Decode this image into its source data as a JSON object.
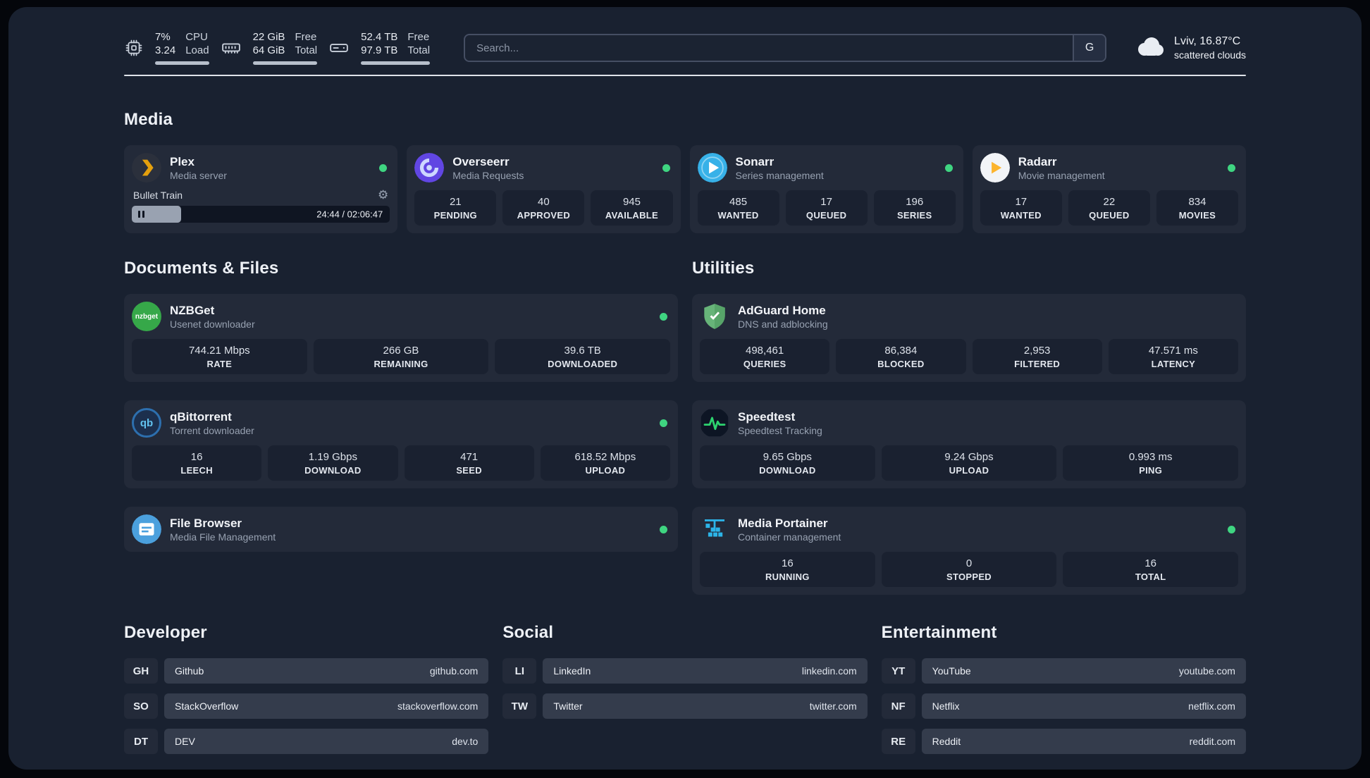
{
  "topbar": {
    "cpu": {
      "value_top": "7%",
      "value_bottom": "3.24",
      "label_top": "CPU",
      "label_bottom": "Load"
    },
    "ram": {
      "value_top": "22 GiB",
      "value_bottom": "64 GiB",
      "label_top": "Free",
      "label_bottom": "Total"
    },
    "disk": {
      "value_top": "52.4 TB",
      "value_bottom": "97.9 TB",
      "label_top": "Free",
      "label_bottom": "Total"
    },
    "search": {
      "placeholder": "Search...",
      "engine_label": "G"
    },
    "weather": {
      "location": "Lviv, 16.87°C",
      "condition": "scattered clouds"
    }
  },
  "sections": {
    "media_title": "Media",
    "documents_title": "Documents & Files",
    "utilities_title": "Utilities"
  },
  "icons": {
    "gear": "⚙"
  },
  "apps": {
    "plex": {
      "name": "Plex",
      "subtitle": "Media server",
      "now_playing": "Bullet Train",
      "time": "24:44 / 02:06:47",
      "progress_style": "width:19%"
    },
    "overseerr": {
      "name": "Overseerr",
      "subtitle": "Media Requests",
      "stats": [
        {
          "value": "21",
          "label": "PENDING"
        },
        {
          "value": "40",
          "label": "APPROVED"
        },
        {
          "value": "945",
          "label": "AVAILABLE"
        }
      ]
    },
    "sonarr": {
      "name": "Sonarr",
      "subtitle": "Series management",
      "stats": [
        {
          "value": "485",
          "label": "WANTED"
        },
        {
          "value": "17",
          "label": "QUEUED"
        },
        {
          "value": "196",
          "label": "SERIES"
        }
      ]
    },
    "radarr": {
      "name": "Radarr",
      "subtitle": "Movie management",
      "stats": [
        {
          "value": "17",
          "label": "WANTED"
        },
        {
          "value": "22",
          "label": "QUEUED"
        },
        {
          "value": "834",
          "label": "MOVIES"
        }
      ]
    },
    "nzbget": {
      "name": "NZBGet",
      "subtitle": "Usenet downloader",
      "icon_text": "nzbget",
      "stats": [
        {
          "value": "744.21 Mbps",
          "label": "RATE"
        },
        {
          "value": "266 GB",
          "label": "REMAINING"
        },
        {
          "value": "39.6 TB",
          "label": "DOWNLOADED"
        }
      ]
    },
    "qbittorrent": {
      "name": "qBittorrent",
      "subtitle": "Torrent downloader",
      "icon_text": "qb",
      "stats": [
        {
          "value": "16",
          "label": "LEECH"
        },
        {
          "value": "1.19 Gbps",
          "label": "DOWNLOAD"
        },
        {
          "value": "471",
          "label": "SEED"
        },
        {
          "value": "618.52 Mbps",
          "label": "UPLOAD"
        }
      ]
    },
    "filebrowser": {
      "name": "File Browser",
      "subtitle": "Media File Management"
    },
    "adguard": {
      "name": "AdGuard Home",
      "subtitle": "DNS and adblocking",
      "stats": [
        {
          "value": "498,461",
          "label": "QUERIES"
        },
        {
          "value": "86,384",
          "label": "BLOCKED"
        },
        {
          "value": "2,953",
          "label": "FILTERED"
        },
        {
          "value": "47.571 ms",
          "label": "LATENCY"
        }
      ]
    },
    "speedtest": {
      "name": "Speedtest",
      "subtitle": "Speedtest Tracking",
      "stats": [
        {
          "value": "9.65 Gbps",
          "label": "DOWNLOAD"
        },
        {
          "value": "9.24 Gbps",
          "label": "UPLOAD"
        },
        {
          "value": "0.993 ms",
          "label": "PING"
        }
      ]
    },
    "portainer": {
      "name": "Media Portainer",
      "subtitle": "Container management",
      "stats": [
        {
          "value": "16",
          "label": "RUNNING"
        },
        {
          "value": "0",
          "label": "STOPPED"
        },
        {
          "value": "16",
          "label": "TOTAL"
        }
      ]
    }
  },
  "bookmarks": [
    {
      "title": "Developer",
      "items": [
        {
          "abbr": "GH",
          "name": "Github",
          "url": "github.com"
        },
        {
          "abbr": "SO",
          "name": "StackOverflow",
          "url": "stackoverflow.com"
        },
        {
          "abbr": "DT",
          "name": "DEV",
          "url": "dev.to"
        }
      ]
    },
    {
      "title": "Social",
      "items": [
        {
          "abbr": "LI",
          "name": "LinkedIn",
          "url": "linkedin.com"
        },
        {
          "abbr": "TW",
          "name": "Twitter",
          "url": "twitter.com"
        }
      ]
    },
    {
      "title": "Entertainment",
      "items": [
        {
          "abbr": "YT",
          "name": "YouTube",
          "url": "youtube.com"
        },
        {
          "abbr": "NF",
          "name": "Netflix",
          "url": "netflix.com"
        },
        {
          "abbr": "RE",
          "name": "Reddit",
          "url": "reddit.com"
        }
      ]
    }
  ],
  "colors": {
    "status_online": "#3fd581",
    "plex_accent": "#e5a00d",
    "divider": "#dfe3e9"
  }
}
